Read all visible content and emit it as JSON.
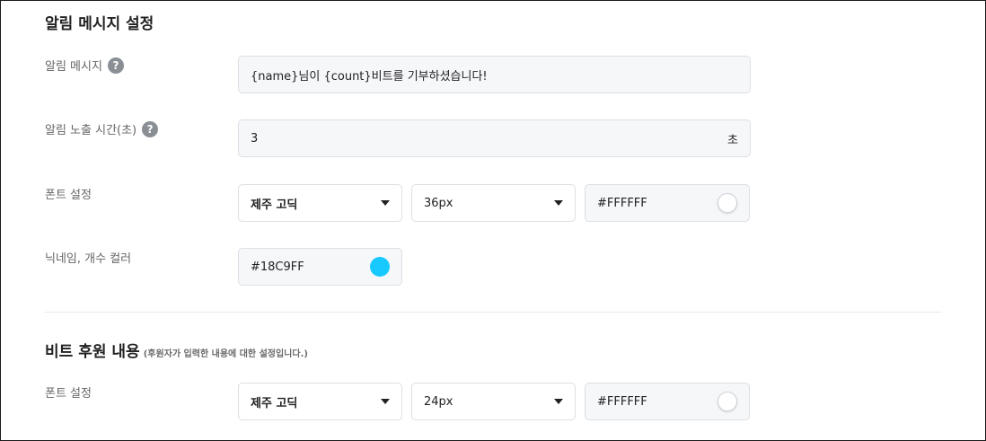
{
  "alert_section": {
    "title": "알림 메시지 설정",
    "message": {
      "label": "알림 메시지",
      "help": "?",
      "value": "{name}님이 {count}비트를 기부하셨습니다!"
    },
    "duration": {
      "label": "알림 노출 시간(초)",
      "help": "?",
      "value": "3",
      "suffix": "초"
    },
    "font": {
      "label": "폰트 설정",
      "family": "제주 고딕",
      "size": "36px",
      "color": "#FFFFFF"
    },
    "nickname_color": {
      "label": "닉네임, 개수 컬러",
      "color": "#18C9FF"
    }
  },
  "donation_section": {
    "title": "비트 후원 내용",
    "subtitle": "(후원자가 입력한 내용에 대한 설정입니다.)",
    "font": {
      "label": "폰트 설정",
      "family": "제주 고딕",
      "size": "24px",
      "color": "#FFFFFF"
    }
  },
  "icons": {
    "dropdown": "chevron-down-icon",
    "help": "question-circle-icon"
  },
  "colors": {
    "swatch_white": "#FFFFFF",
    "swatch_accent": "#18C9FF"
  }
}
